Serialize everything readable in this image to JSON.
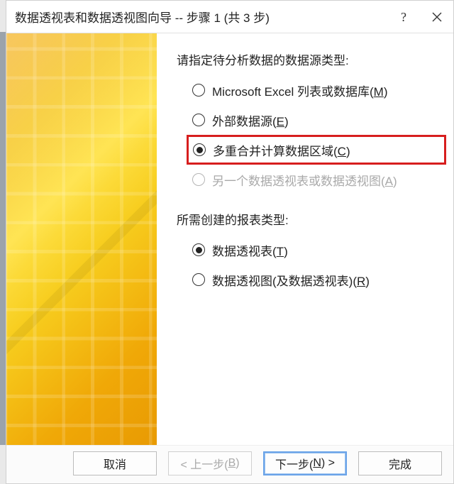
{
  "title": "数据透视表和数据透视图向导 -- 步骤 1 (共 3 步)",
  "section1": {
    "label": "请指定待分析数据的数据源类型:",
    "options": [
      {
        "text": "Microsoft Excel 列表或数据库(",
        "hotkey": "M",
        "suffix": ")",
        "selected": false,
        "disabled": false,
        "highlight": false
      },
      {
        "text": "外部数据源(",
        "hotkey": "E",
        "suffix": ")",
        "selected": false,
        "disabled": false,
        "highlight": false
      },
      {
        "text": "多重合并计算数据区域(",
        "hotkey": "C",
        "suffix": ")",
        "selected": true,
        "disabled": false,
        "highlight": true
      },
      {
        "text": "另一个数据透视表或数据透视图(",
        "hotkey": "A",
        "suffix": ")",
        "selected": false,
        "disabled": true,
        "highlight": false
      }
    ]
  },
  "section2": {
    "label": "所需创建的报表类型:",
    "options": [
      {
        "text": "数据透视表(",
        "hotkey": "T",
        "suffix": ")",
        "selected": true,
        "disabled": false
      },
      {
        "text": "数据透视图(及数据透视表)(",
        "hotkey": "R",
        "suffix": ")",
        "selected": false,
        "disabled": false
      }
    ]
  },
  "buttons": {
    "cancel": "取消",
    "back_pre": "< 上一步(",
    "back_hk": "B",
    "back_suf": ")",
    "next_pre": "下一步(",
    "next_hk": "N",
    "next_suf": ") >",
    "finish": "完成"
  }
}
